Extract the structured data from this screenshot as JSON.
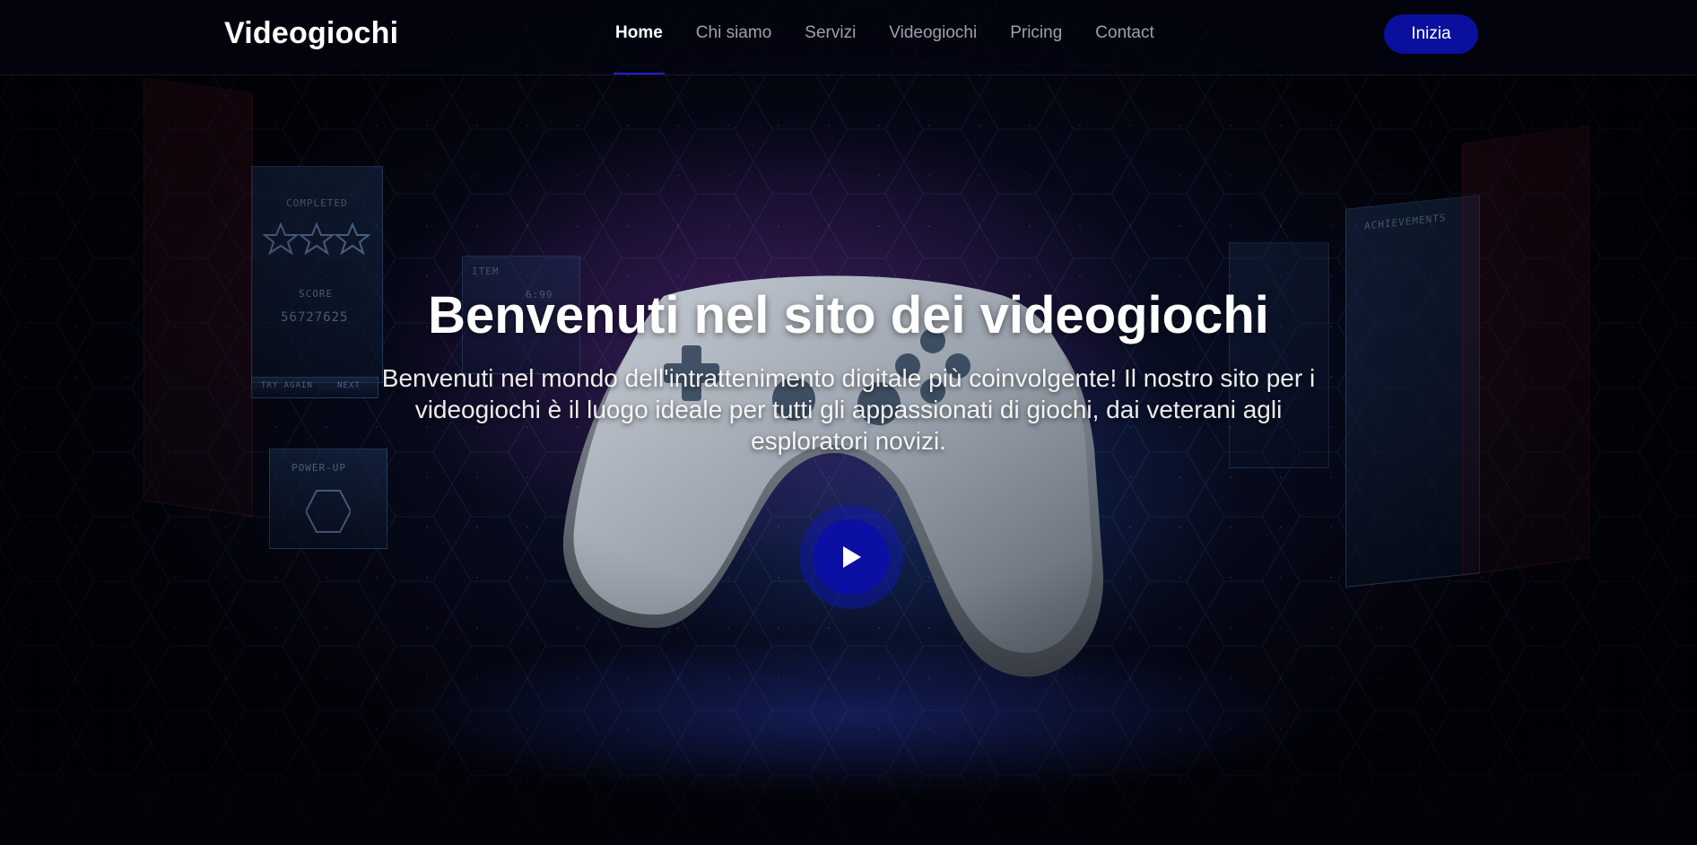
{
  "brand": {
    "name": "Videogiochi"
  },
  "nav": {
    "items": [
      {
        "label": "Home",
        "active": true
      },
      {
        "label": "Chi siamo",
        "active": false
      },
      {
        "label": "Servizi",
        "active": false
      },
      {
        "label": "Videogiochi",
        "active": false
      },
      {
        "label": "Pricing",
        "active": false
      },
      {
        "label": "Contact",
        "active": false
      }
    ]
  },
  "header": {
    "cta_label": "Inizia"
  },
  "hero": {
    "title": "Benvenuti nel sito dei videogiochi",
    "subtitle": "Benvenuti nel mondo dell'intrattenimento digitale più coinvolgente! Il nostro sito per i videogiochi è il luogo ideale per tutti gli appassionati di giochi, dai veterani agli esploratori novizi.",
    "play_icon": "play-icon"
  },
  "background": {
    "hud_labels": [
      "COMPLETED",
      "SCORE",
      "56727625",
      "POWER-UP",
      "ITEM",
      "6:99",
      "ACHIEVEMENTS",
      "TRY AGAIN",
      "NEXT"
    ]
  },
  "colors": {
    "accent": "#0b0fa3",
    "background": "#04050f",
    "text": "#ffffff",
    "nav_inactive": "#9a9aa8"
  }
}
